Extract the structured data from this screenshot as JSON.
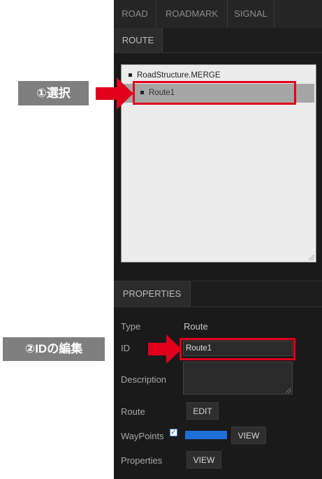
{
  "tabs": {
    "top": [
      "ROAD",
      "ROADMARK",
      "SIGNAL"
    ],
    "active": "ROUTE"
  },
  "route_list": {
    "items": [
      "RoadStructure.MERGE",
      "Route1"
    ],
    "selected_index": 1
  },
  "properties": {
    "tab_label": "PROPERTIES",
    "type_label": "Type",
    "type_value": "Route",
    "id_label": "ID",
    "id_value": "Route1",
    "description_label": "Description",
    "description_value": "",
    "route_label": "Route",
    "route_edit": "EDIT",
    "waypoints_label": "WayPoints",
    "waypoints_checked": true,
    "waypoints_color": "#1e6fd9",
    "waypoints_view": "VIEW",
    "properties_label": "Properties",
    "properties_view": "VIEW"
  },
  "callouts": {
    "step1": "①選択",
    "step2": "②IDの編集"
  },
  "colors": {
    "panel_bg": "#1a1a1a",
    "highlight_red": "#e0001b",
    "callout_gray": "#7f7f7f",
    "selected_row": "#a6a6a6"
  }
}
